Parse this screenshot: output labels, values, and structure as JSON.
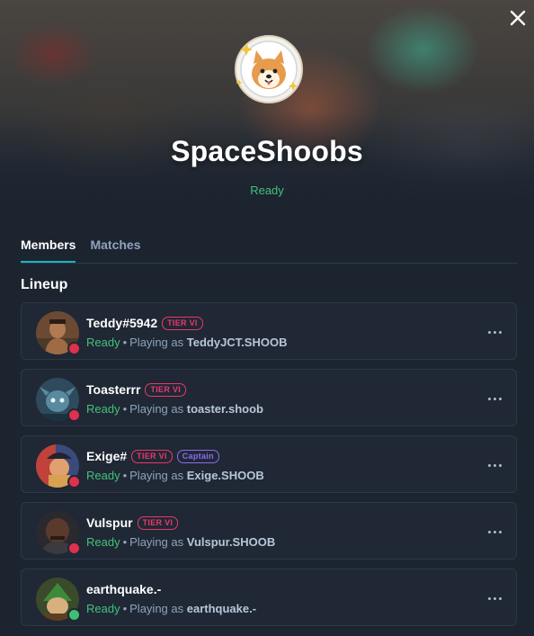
{
  "team": {
    "name": "SpaceShoobs",
    "status": "Ready"
  },
  "tabs": [
    {
      "label": "Members",
      "active": true
    },
    {
      "label": "Matches",
      "active": false
    }
  ],
  "lineup": {
    "title": "Lineup",
    "ready_label": "Ready",
    "separator": "•",
    "playing_as_label": "Playing as",
    "members": [
      {
        "name": "Teddy#5942",
        "badges": [
          "TIER VI"
        ],
        "status": "Ready",
        "handle": "TeddyJCT.SHOOB",
        "presence": "offline"
      },
      {
        "name": "Toasterrr",
        "badges": [
          "TIER VI"
        ],
        "status": "Ready",
        "handle": "toaster.shoob",
        "presence": "offline"
      },
      {
        "name": "Exige#",
        "badges": [
          "TIER VI",
          "Captain"
        ],
        "status": "Ready",
        "handle": "Exige.SHOOB",
        "presence": "offline"
      },
      {
        "name": "Vulspur",
        "badges": [
          "TIER VI"
        ],
        "status": "Ready",
        "handle": "Vulspur.SHOOB",
        "presence": "offline"
      },
      {
        "name": "earthquake.-",
        "badges": [],
        "status": "Ready",
        "handle": "earthquake.-",
        "presence": "online"
      }
    ]
  },
  "colors": {
    "accent": "#18b3c0",
    "ready": "#45c07a",
    "tier_badge": "#e8396b",
    "captain_badge": "#8c6cf0",
    "offline": "#e0304e",
    "online": "#3fbf72"
  },
  "icons": {
    "close": "close-icon",
    "more": "more-options-icon"
  }
}
